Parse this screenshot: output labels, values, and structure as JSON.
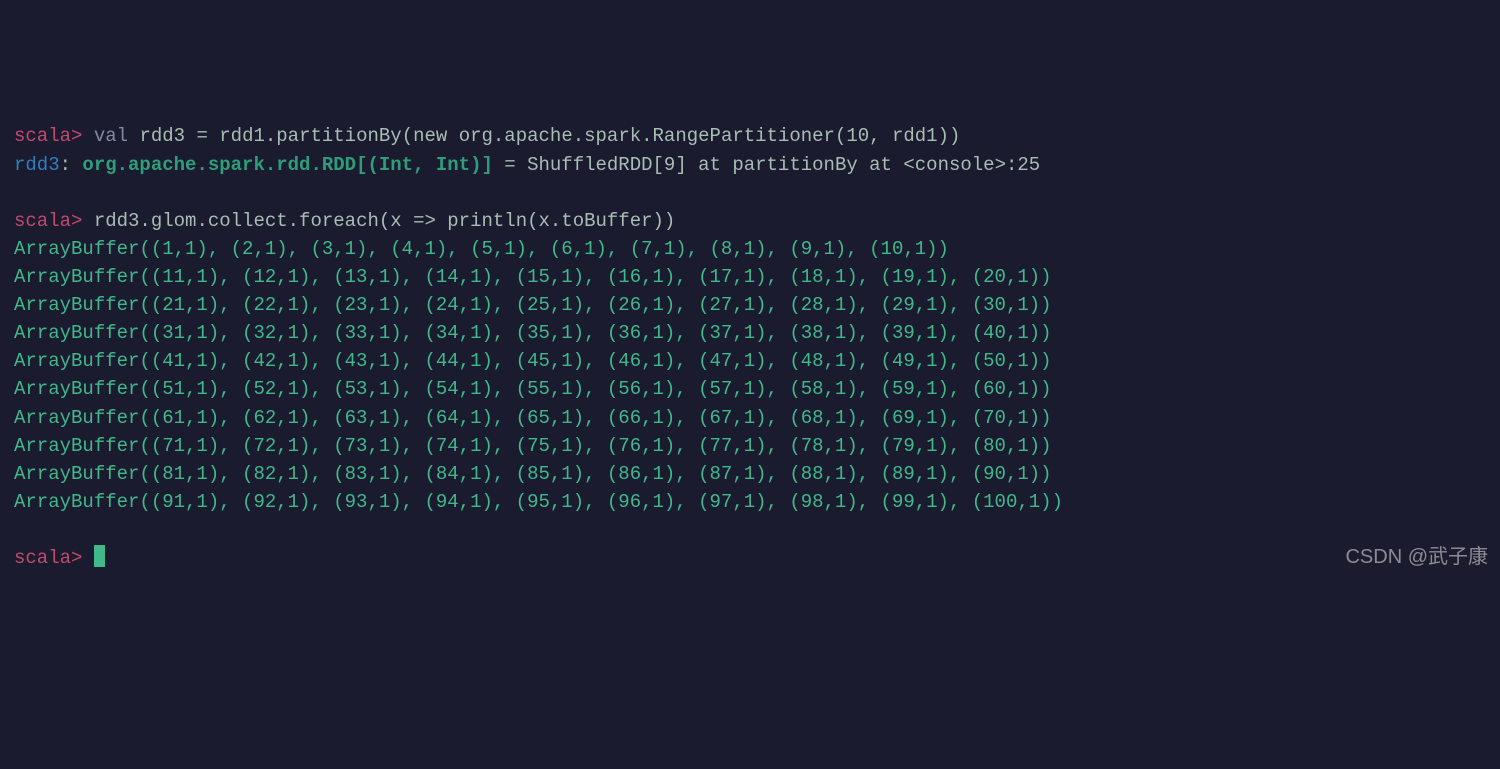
{
  "prompt_label": "scala>",
  "cmd1": {
    "keyword": "val",
    "rest": " rdd3 = rdd1.partitionBy(new org.apache.spark.RangePartitioner(10, rdd1))"
  },
  "result1": {
    "var_label": "rdd3",
    "colon_space": ": ",
    "type_str": "org.apache.spark.rdd.RDD[(Int, Int)]",
    "rest": " = ShuffledRDD[9] at partitionBy at <console>:25"
  },
  "cmd2": " rdd3.glom.collect.foreach(x => println(x.toBuffer))",
  "output_lines": [
    "ArrayBuffer((1,1), (2,1), (3,1), (4,1), (5,1), (6,1), (7,1), (8,1), (9,1), (10,1))",
    "ArrayBuffer((11,1), (12,1), (13,1), (14,1), (15,1), (16,1), (17,1), (18,1), (19,1), (20,1))",
    "ArrayBuffer((21,1), (22,1), (23,1), (24,1), (25,1), (26,1), (27,1), (28,1), (29,1), (30,1))",
    "ArrayBuffer((31,1), (32,1), (33,1), (34,1), (35,1), (36,1), (37,1), (38,1), (39,1), (40,1))",
    "ArrayBuffer((41,1), (42,1), (43,1), (44,1), (45,1), (46,1), (47,1), (48,1), (49,1), (50,1))",
    "ArrayBuffer((51,1), (52,1), (53,1), (54,1), (55,1), (56,1), (57,1), (58,1), (59,1), (60,1))",
    "ArrayBuffer((61,1), (62,1), (63,1), (64,1), (65,1), (66,1), (67,1), (68,1), (69,1), (70,1))",
    "ArrayBuffer((71,1), (72,1), (73,1), (74,1), (75,1), (76,1), (77,1), (78,1), (79,1), (80,1))",
    "ArrayBuffer((81,1), (82,1), (83,1), (84,1), (85,1), (86,1), (87,1), (88,1), (89,1), (90,1))",
    "ArrayBuffer((91,1), (92,1), (93,1), (94,1), (95,1), (96,1), (97,1), (98,1), (99,1), (100,1))"
  ],
  "watermark": "CSDN @武子康"
}
